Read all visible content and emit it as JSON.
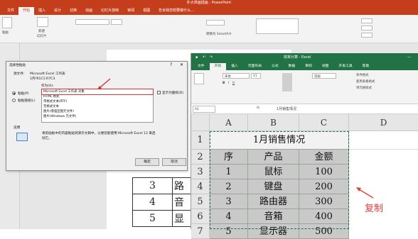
{
  "powerpoint": {
    "title": "扑大师画插画 - PowerPoint",
    "tabs": [
      "文件",
      "开始",
      "插入",
      "设计",
      "切换",
      "动画",
      "幻灯片放映",
      "审阅",
      "视图",
      "告诉我您想要做什么..."
    ],
    "ribbon": {
      "paste": "粘贴",
      "new_slide": "新建",
      "slide_label": "幻灯片",
      "smartart": "转换为 SmartArt"
    },
    "slide_table": [
      [
        "3",
        "路"
      ],
      [
        "4",
        "音"
      ],
      [
        "5",
        "显"
      ]
    ]
  },
  "dialog": {
    "title": "选择性粘贴",
    "source_label": "源文件:",
    "source_value": "Microsoft Excel 工作表",
    "source_range": "1月!R1C1:R7C3",
    "as_label": "作为(A):",
    "radio_paste": "粘贴(P)",
    "radio_link": "粘贴链接(L)",
    "items": [
      "Microsoft Excel 工作表 对象",
      "HTML 格式",
      "带格式文本(RTF)",
      "无格式文本",
      "图片(增强型图元文件)",
      "图片(Windows 元文件)"
    ],
    "show_as_icon": "显示为图标(D)",
    "result_label": "说明",
    "result_text": "将剪贴板中的内容粘贴到演示文稿中，以便您能使用 Microsoft Excel 12 来启动它。",
    "ok": "确定",
    "cancel": "取消"
  },
  "excel": {
    "title": "效率计算 - Excel",
    "tabs": [
      "文件",
      "开始",
      "插入",
      "页面布局",
      "公式",
      "数据",
      "审阅",
      "视图",
      "开发工具",
      "帮助"
    ],
    "ribbon": {
      "font": "宋体",
      "size": "11",
      "number_format": "常规",
      "cond_format": "条件格式",
      "table_format": "套用表格格式",
      "cell_style": "单元格样式"
    },
    "name_box": "A1",
    "formula": "1月销售情况",
    "col_headers": [
      "A",
      "B",
      "C",
      "D"
    ],
    "row_headers": [
      "1",
      "2",
      "3",
      "4",
      "5",
      "6",
      "7"
    ],
    "sheet_title": "1月销售情况",
    "table_headers": [
      "序",
      "产品",
      "金额"
    ],
    "rows": [
      [
        "1",
        "鼠标",
        "100"
      ],
      [
        "2",
        "键盘",
        "200"
      ],
      [
        "3",
        "路由器",
        "300"
      ],
      [
        "4",
        "音箱",
        "400"
      ],
      [
        "5",
        "显示器",
        "500"
      ]
    ],
    "annotation": "复制"
  },
  "colors": {
    "ppt_accent": "#c43e1c",
    "excel_accent": "#217346",
    "highlight": "#d33333"
  }
}
